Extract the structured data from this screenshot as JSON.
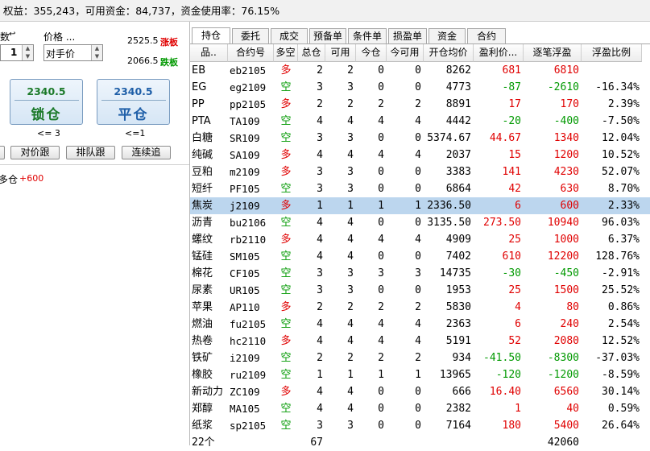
{
  "topbar": {
    "text": "权益：355,243，可用资金：84,737，资金使用率：76.15%"
  },
  "left": {
    "qty_label": "数",
    "qty_value": "1",
    "price_label": "价格 ...",
    "price_value": "对手价",
    "limit_up_price": "2525.5",
    "limit_up_label": "涨板",
    "limit_down_price": "2066.5",
    "limit_down_label": "跌板",
    "lock_price": "2340.5",
    "lock_label": "锁仓",
    "lock_limit": "<= 3",
    "close_price": "2340.5",
    "close_label": "平仓",
    "close_limit": "<=1",
    "follow_counter_label": "对价跟",
    "follow_queue_label": "排队跟",
    "chase_label": "连续追",
    "position_label": "多仓",
    "position_value": "+600"
  },
  "tabs": [
    "持仓",
    "委托",
    "成交",
    "预备单",
    "条件单",
    "损盈单",
    "资金",
    "合约"
  ],
  "columns": [
    "品..",
    "合约号",
    "多空",
    "总仓",
    "可用",
    "今仓",
    "今可用",
    "开仓均价",
    "盈利价...",
    "逐笔浮盈",
    "浮盈比例"
  ],
  "rows": [
    {
      "name": "EB",
      "code": "eb2105",
      "dir": "多",
      "total": "2",
      "avail": "2",
      "today": "0",
      "today_avail": "0",
      "avg": "8262",
      "pl_tick": "681",
      "float_pl": "6810",
      "ratio": ""
    },
    {
      "name": "EG",
      "code": "eg2109",
      "dir": "空",
      "total": "3",
      "avail": "3",
      "today": "0",
      "today_avail": "0",
      "avg": "4773",
      "pl_tick": "-87",
      "float_pl": "-2610",
      "ratio": "-16.34%"
    },
    {
      "name": "PP",
      "code": "pp2105",
      "dir": "多",
      "total": "2",
      "avail": "2",
      "today": "2",
      "today_avail": "2",
      "avg": "8891",
      "pl_tick": "17",
      "float_pl": "170",
      "ratio": "2.39%"
    },
    {
      "name": "PTA",
      "code": "TA109",
      "dir": "空",
      "total": "4",
      "avail": "4",
      "today": "4",
      "today_avail": "4",
      "avg": "4442",
      "pl_tick": "-20",
      "float_pl": "-400",
      "ratio": "-7.50%"
    },
    {
      "name": "白糖",
      "code": "SR109",
      "dir": "空",
      "total": "3",
      "avail": "3",
      "today": "0",
      "today_avail": "0",
      "avg": "5374.67",
      "pl_tick": "44.67",
      "float_pl": "1340",
      "ratio": "12.04%"
    },
    {
      "name": "纯碱",
      "code": "SA109",
      "dir": "多",
      "total": "4",
      "avail": "4",
      "today": "4",
      "today_avail": "4",
      "avg": "2037",
      "pl_tick": "15",
      "float_pl": "1200",
      "ratio": "10.52%"
    },
    {
      "name": "豆粕",
      "code": "m2109",
      "dir": "多",
      "total": "3",
      "avail": "3",
      "today": "0",
      "today_avail": "0",
      "avg": "3383",
      "pl_tick": "141",
      "float_pl": "4230",
      "ratio": "52.07%"
    },
    {
      "name": "短纤",
      "code": "PF105",
      "dir": "空",
      "total": "3",
      "avail": "3",
      "today": "0",
      "today_avail": "0",
      "avg": "6864",
      "pl_tick": "42",
      "float_pl": "630",
      "ratio": "8.70%"
    },
    {
      "name": "焦炭",
      "code": "j2109",
      "dir": "多",
      "total": "1",
      "avail": "1",
      "today": "1",
      "today_avail": "1",
      "avg": "2336.50",
      "pl_tick": "6",
      "float_pl": "600",
      "ratio": "2.33%"
    },
    {
      "name": "沥青",
      "code": "bu2106",
      "dir": "空",
      "total": "4",
      "avail": "4",
      "today": "0",
      "today_avail": "0",
      "avg": "3135.50",
      "pl_tick": "273.50",
      "float_pl": "10940",
      "ratio": "96.03%"
    },
    {
      "name": "螺纹",
      "code": "rb2110",
      "dir": "多",
      "total": "4",
      "avail": "4",
      "today": "4",
      "today_avail": "4",
      "avg": "4909",
      "pl_tick": "25",
      "float_pl": "1000",
      "ratio": "6.37%"
    },
    {
      "name": "锰硅",
      "code": "SM105",
      "dir": "空",
      "total": "4",
      "avail": "4",
      "today": "0",
      "today_avail": "0",
      "avg": "7402",
      "pl_tick": "610",
      "float_pl": "12200",
      "ratio": "128.76%"
    },
    {
      "name": "棉花",
      "code": "CF105",
      "dir": "空",
      "total": "3",
      "avail": "3",
      "today": "3",
      "today_avail": "3",
      "avg": "14735",
      "pl_tick": "-30",
      "float_pl": "-450",
      "ratio": "-2.91%"
    },
    {
      "name": "尿素",
      "code": "UR105",
      "dir": "空",
      "total": "3",
      "avail": "3",
      "today": "0",
      "today_avail": "0",
      "avg": "1953",
      "pl_tick": "25",
      "float_pl": "1500",
      "ratio": "25.52%"
    },
    {
      "name": "苹果",
      "code": "AP110",
      "dir": "多",
      "total": "2",
      "avail": "2",
      "today": "2",
      "today_avail": "2",
      "avg": "5830",
      "pl_tick": "4",
      "float_pl": "80",
      "ratio": "0.86%"
    },
    {
      "name": "燃油",
      "code": "fu2105",
      "dir": "空",
      "total": "4",
      "avail": "4",
      "today": "4",
      "today_avail": "4",
      "avg": "2363",
      "pl_tick": "6",
      "float_pl": "240",
      "ratio": "2.54%"
    },
    {
      "name": "热卷",
      "code": "hc2110",
      "dir": "多",
      "total": "4",
      "avail": "4",
      "today": "4",
      "today_avail": "4",
      "avg": "5191",
      "pl_tick": "52",
      "float_pl": "2080",
      "ratio": "12.52%"
    },
    {
      "name": "铁矿",
      "code": "i2109",
      "dir": "空",
      "total": "2",
      "avail": "2",
      "today": "2",
      "today_avail": "2",
      "avg": "934",
      "pl_tick": "-41.50",
      "float_pl": "-8300",
      "ratio": "-37.03%"
    },
    {
      "name": "橡胶",
      "code": "ru2109",
      "dir": "空",
      "total": "1",
      "avail": "1",
      "today": "1",
      "today_avail": "1",
      "avg": "13965",
      "pl_tick": "-120",
      "float_pl": "-1200",
      "ratio": "-8.59%"
    },
    {
      "name": "新动力",
      "code": "ZC109",
      "dir": "多",
      "total": "4",
      "avail": "4",
      "today": "0",
      "today_avail": "0",
      "avg": "666",
      "pl_tick": "16.40",
      "float_pl": "6560",
      "ratio": "30.14%"
    },
    {
      "name": "郑醇",
      "code": "MA105",
      "dir": "空",
      "total": "4",
      "avail": "4",
      "today": "0",
      "today_avail": "0",
      "avg": "2382",
      "pl_tick": "1",
      "float_pl": "40",
      "ratio": "0.59%"
    },
    {
      "name": "纸浆",
      "code": "sp2105",
      "dir": "空",
      "total": "3",
      "avail": "3",
      "today": "0",
      "today_avail": "0",
      "avg": "7164",
      "pl_tick": "180",
      "float_pl": "5400",
      "ratio": "26.64%"
    }
  ],
  "selected_row": 8,
  "footer": {
    "count": "22个",
    "total": "67",
    "float_total": "42060"
  },
  "colors": {
    "up": "#e00000",
    "down": "#009900",
    "selected": "#bcd6ee"
  }
}
